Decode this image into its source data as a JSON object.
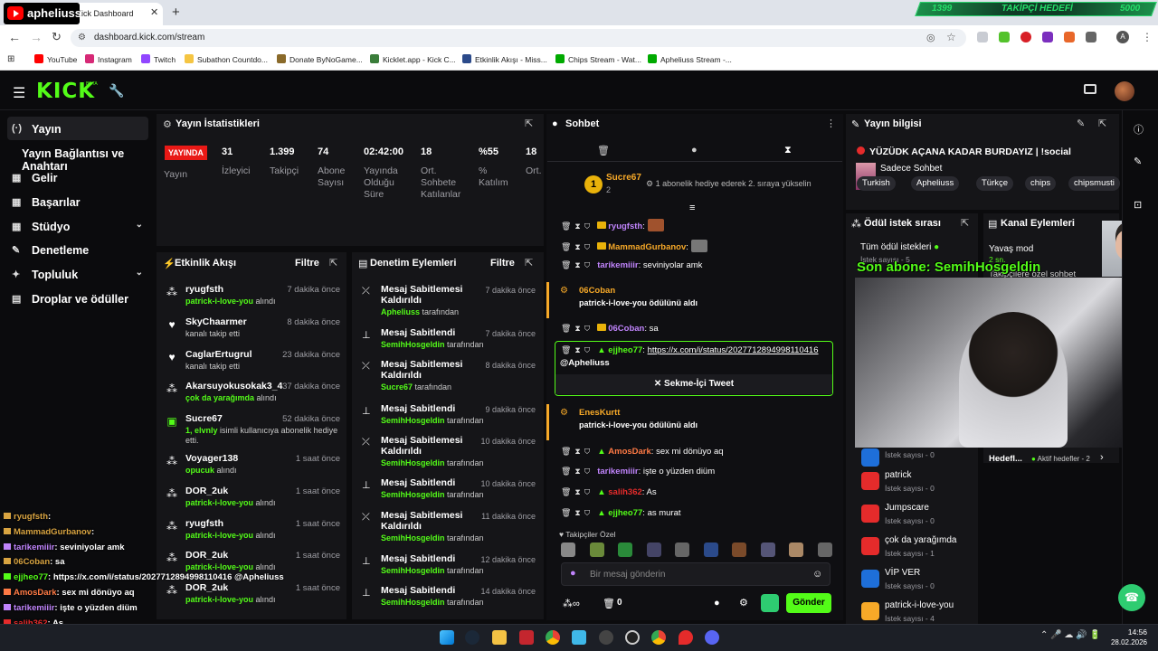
{
  "browser": {
    "tab_title": "Kick Dashboard",
    "url": "dashboard.kick.com/stream",
    "goal": {
      "left": "1399",
      "title": "TAKİPÇİ HEDEFİ",
      "right": "5000"
    },
    "bookmarks": [
      "YouTube",
      "Instagram",
      "Twitch",
      "Subathon Countdo...",
      "Donate ByNoGame...",
      "Kicklet.app - Kick C...",
      "Etkinlik Akışı - Miss...",
      "Chips Stream - Wat...",
      "Apheliuss Stream -..."
    ]
  },
  "channel_logo": "apheliuss",
  "kick": {
    "logo": "KICK",
    "beta": "BETA"
  },
  "sidebar": {
    "items": [
      {
        "label": "Yayın",
        "icon": "(·)"
      },
      {
        "label": "Yayın Bağlantısı ve Anahtarı",
        "icon": ""
      },
      {
        "label": "Gelir",
        "icon": "▦"
      },
      {
        "label": "Başarılar",
        "icon": "▦"
      },
      {
        "label": "Stüdyo",
        "icon": "▦"
      },
      {
        "label": "Denetleme",
        "icon": "✎"
      },
      {
        "label": "Topluluk",
        "icon": "✦"
      },
      {
        "label": "Droplar ve ödüller",
        "icon": "▤"
      }
    ]
  },
  "stats": {
    "title": "Yayın İstatistikleri",
    "live": "YAYINDA",
    "status_label": "Yayın",
    "values": [
      {
        "v": "31",
        "l": "İzleyici"
      },
      {
        "v": "1.399",
        "l": "Takipçi"
      },
      {
        "v": "74",
        "l": "Abone Sayısı"
      },
      {
        "v": "02:42:00",
        "l": "Yayında Olduğu Süre"
      },
      {
        "v": "18",
        "l": "Ort. Sohbete Katılanlar"
      },
      {
        "v": "%55",
        "l": "% Katılım"
      },
      {
        "v": "18",
        "l": "Ort. Soht Katılı"
      }
    ]
  },
  "activity": {
    "title": "Etkinlik Akışı",
    "filter": "Filtre",
    "items": [
      {
        "name": "ryugfsth",
        "sub_green": "patrick-i-love-you",
        "sub": " alındı",
        "time": "7 dakika önce"
      },
      {
        "name": "SkyChaarmer",
        "sub_green": "",
        "sub": "kanalı takip etti",
        "time": "8 dakika önce"
      },
      {
        "name": "CaglarErtugrul",
        "sub_green": "",
        "sub": "kanalı takip etti",
        "time": "23 dakika önce"
      },
      {
        "name": "Akarsuyokusokak3_4",
        "sub_green": "çok da yarağımda",
        "sub": " alındı",
        "time": "37 dakika önce"
      },
      {
        "name": "Sucre67",
        "sub_green": "1, elvnly",
        "sub": " isimli kullanıcıya abonelik hediye etti.",
        "time": "52 dakika önce"
      },
      {
        "name": "Voyager138",
        "sub_green": "opucuk",
        "sub": " alındı",
        "time": "1 saat önce"
      },
      {
        "name": "DOR_2uk",
        "sub_green": "patrick-i-love-you",
        "sub": " alındı",
        "time": "1 saat önce"
      },
      {
        "name": "ryugfsth",
        "sub_green": "patrick-i-love-you",
        "sub": " alındı",
        "time": "1 saat önce"
      },
      {
        "name": "DOR_2uk",
        "sub_green": "patrick-i-love-you",
        "sub": " alındı",
        "time": "1 saat önce"
      },
      {
        "name": "DOR_2uk",
        "sub_green": "patrick-i-love-you",
        "sub": " alındı",
        "time": "1 saat önce"
      }
    ]
  },
  "moderation": {
    "title": "Denetim Eylemleri",
    "filter": "Filtre",
    "items": [
      {
        "title": "Mesaj Sabitlemesi Kaldırıldı",
        "by": "Apheliuss",
        "suffix": " tarafından",
        "time": "7 dakika önce",
        "kind": "unpin"
      },
      {
        "title": "Mesaj Sabitlendi",
        "by": "SemihHosgeldin",
        "suffix": " tarafından",
        "time": "7 dakika önce",
        "kind": "pin"
      },
      {
        "title": "Mesaj Sabitlemesi Kaldırıldı",
        "by": "Sucre67",
        "suffix": " tarafından",
        "time": "8 dakika önce",
        "kind": "unpin"
      },
      {
        "title": "Mesaj Sabitlendi",
        "by": "SemihHosgeldin",
        "suffix": " tarafından",
        "time": "9 dakika önce",
        "kind": "pin"
      },
      {
        "title": "Mesaj Sabitlemesi Kaldırıldı",
        "by": "SemihHosgeldin",
        "suffix": " tarafından",
        "time": "10 dakika önce",
        "kind": "unpin"
      },
      {
        "title": "Mesaj Sabitlendi",
        "by": "SemihHosgeldin",
        "suffix": " tarafından",
        "time": "10 dakika önce",
        "kind": "pin"
      },
      {
        "title": "Mesaj Sabitlemesi Kaldırıldı",
        "by": "SemihHosgeldin",
        "suffix": " tarafından",
        "time": "11 dakika önce",
        "kind": "unpin"
      },
      {
        "title": "Mesaj Sabitlendi",
        "by": "SemihHosgeldin",
        "suffix": " tarafından",
        "time": "12 dakika önce",
        "kind": "pin"
      },
      {
        "title": "Mesaj Sabitlendi",
        "by": "SemihHosgeldin",
        "suffix": " tarafından",
        "time": "14 dakika önce",
        "kind": "pin"
      }
    ]
  },
  "chat": {
    "title": "Sohbet",
    "gift_user": "Sucre67",
    "gift_count": "2",
    "gift_text": "1 abonelik hediye ederek 2. sıraya yükselin",
    "m1_user": "ryugfsth",
    "m2_user": "MammadGurbanov",
    "m3_user": "tarikemiiir",
    "m3_text": ": seviniyolar amk",
    "r1_user": "06Coban",
    "r1_text": "patrick-i-love-you ödülünü aldı",
    "m4_user": "06Coban",
    "m4_text": ": sa",
    "m5_user": "ejjheo77",
    "m5_link": "https://x.com/i/status/2027712894998110416",
    "m5_mention": "@Apheliuss",
    "tweet_btn": "Sekme-İçi Tweet",
    "r2_user": "EnesKurtt",
    "r2_text": "patrick-i-love-you ödülünü aldı",
    "m6_user": "AmosDark",
    "m6_text": ": sex mi dönüyo aq",
    "m7_user": "tarikemiiir",
    "m7_text": ": işte o yüzden diüm",
    "m8_user": "salih362",
    "m8_text": ": As",
    "m9_user": "ejjheo77",
    "m9_text": ": as murat",
    "fav_label": "Takipçiler Özel",
    "input_placeholder": "Bir mesaj gönderin",
    "send": "Gönder",
    "count": "0"
  },
  "info": {
    "title": "Yayın bilgisi",
    "stream_title": "YÜZÜDK AÇANA KADAR BURDAYIZ | !social",
    "category": "Sadece Sohbet",
    "tags": [
      "Turkish",
      "Apheliuss",
      "Türkçe",
      "chips",
      "chipsmusti"
    ]
  },
  "rewards": {
    "title": "Ödül istek sırası",
    "all": "Tüm ödül istekleri",
    "count_label": "İstek sayısı - 5",
    "items": [
      {
        "name": "",
        "count": "İstek sayısı - 0"
      },
      {
        "name": "patrick",
        "count": "İstek sayısı - 0"
      },
      {
        "name": "Jumpscare",
        "count": "İstek sayısı - 0"
      },
      {
        "name": "çok da yarağımda",
        "count": "İstek sayısı - 1"
      },
      {
        "name": "VİP VER",
        "count": "İstek sayısı - 0"
      },
      {
        "name": "patrick-i-love-you",
        "count": "İstek sayısı - 4"
      }
    ]
  },
  "channel_actions": {
    "title": "Kanal Eylemleri",
    "slow_mode": "Yavaş mod",
    "slow_val": "2 sn.",
    "sub_only": "Takipçilere özel sohbet",
    "goals": "Hedefl...",
    "active_goals": "Aktif hedefler - 2"
  },
  "overlay": {
    "last_sub": "Son abone: SemihHosgeldin",
    "chat": [
      {
        "user": "ryugfsth",
        "text": ":",
        "color": "#d9a441"
      },
      {
        "user": "MammadGurbanov",
        "text": ":",
        "color": "#d9a441"
      },
      {
        "user": "tarikemiiir",
        "text": ": seviniyolar amk",
        "color": "#c084fc"
      },
      {
        "user": "06Coban",
        "text": ": sa",
        "color": "#d9a441"
      },
      {
        "user": "ejjheo77",
        "text": ": https://x.com/i/status/2027712894998110416 @Apheliuss",
        "color": "#53fc18"
      },
      {
        "user": "AmosDark",
        "text": ": sex mi dönüyo aq",
        "color": "#ff7a45"
      },
      {
        "user": "tarikemiiir",
        "text": ": işte o yüzden diüm",
        "color": "#c084fc"
      },
      {
        "user": "salih362",
        "text": ": As",
        "color": "#e52b2b"
      }
    ]
  },
  "taskbar": {
    "time": "14:56",
    "date": "28.02.2026"
  }
}
